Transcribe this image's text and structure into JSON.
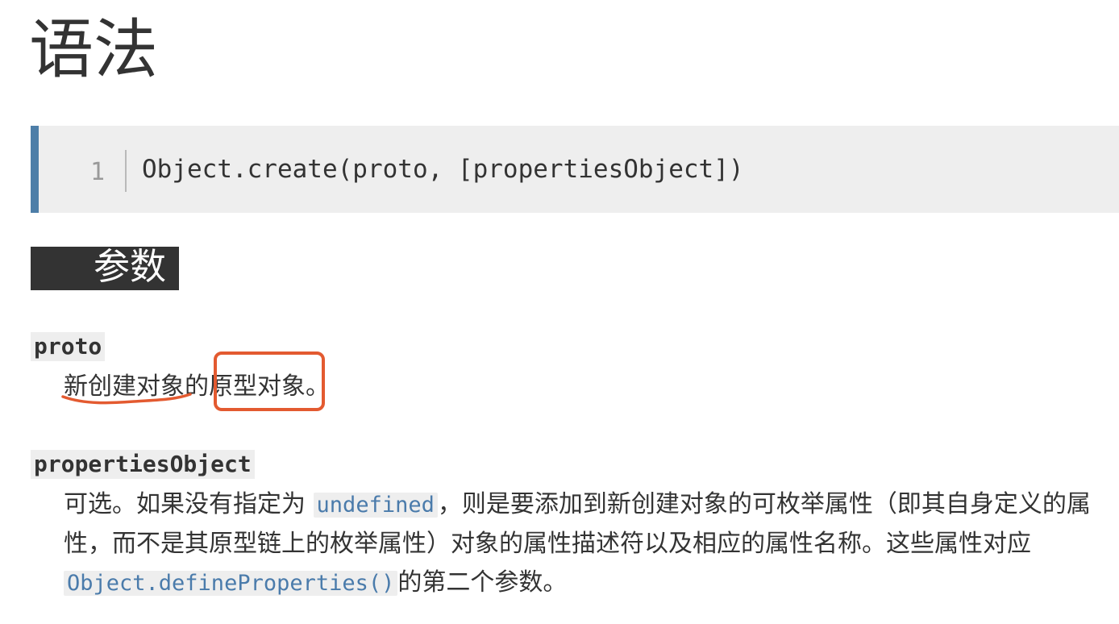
{
  "syntax": {
    "title": "语法",
    "code": {
      "line_number": "1",
      "text": "Object.create(proto, [propertiesObject])"
    }
  },
  "parameters": {
    "heading": "参数",
    "proto": {
      "name": "proto",
      "desc_part1": "新创建对象",
      "desc_part2": "的",
      "desc_part3": "原型对象",
      "desc_part4": "。"
    },
    "propertiesObject": {
      "name": "propertiesObject",
      "desc_part1": "可选。如果没有指定为 ",
      "code1": "undefined",
      "desc_part2": "，则是要添加到新创建对象的可枚举属性（即其自身定义的属性，而不是其原型链上的枚举属性）对象的属性描述符以及相应的属性名称。这些属性对应",
      "code2": "Object.defineProperties()",
      "desc_part3": "的第二个参数。"
    }
  },
  "annotations": {
    "color": "#e35a30"
  }
}
